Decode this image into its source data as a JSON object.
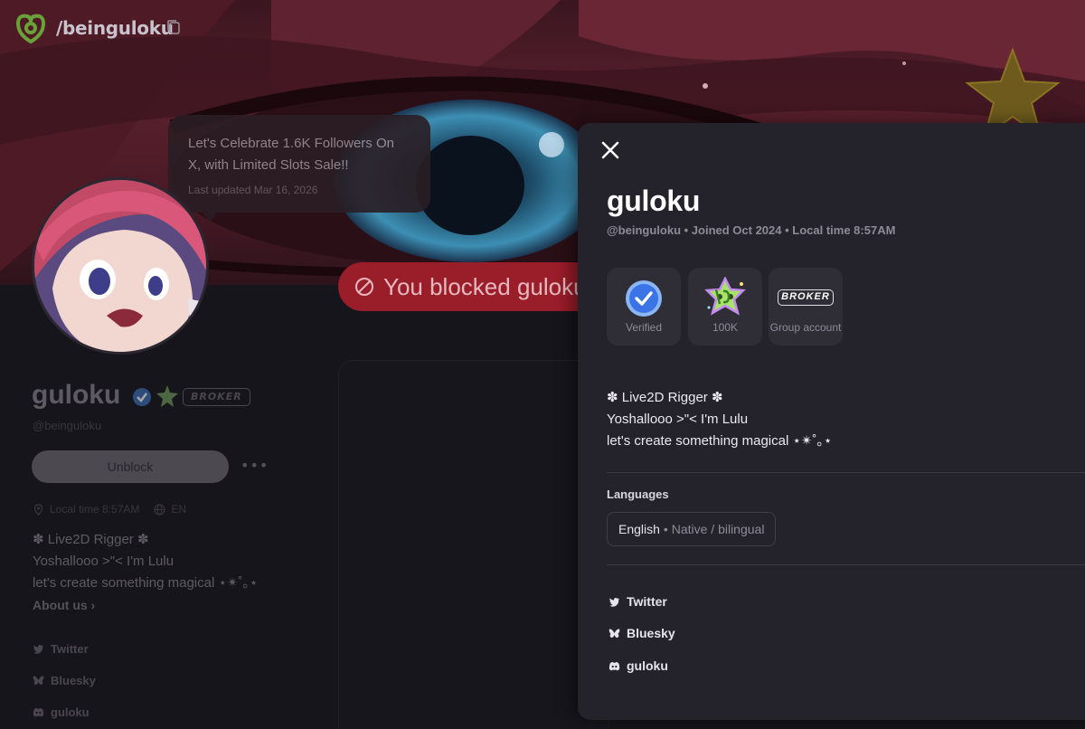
{
  "topbar": {
    "handle": "/beinguloku"
  },
  "banner": {
    "announcement": "Let's Celebrate 1.6K Followers On X, with Limited Slots Sale!!",
    "last_updated": "Last updated Mar 16, 2026",
    "blocked_message": "You blocked guloku"
  },
  "profile": {
    "name": "guloku",
    "handle": "@beinguloku",
    "broker_tag": "BROKER",
    "unblock_label": "Unblock",
    "more_label": "•••",
    "local_time": "Local time 8:57AM",
    "language_code": "EN",
    "bio": [
      "✽ Live2D Rigger ✽",
      "Yoshallooo >\"< I'm Lulu",
      "let's create something magical ⋆✴︎˚｡⋆"
    ],
    "about_label": "About us ›",
    "socials": [
      "Twitter",
      "Bluesky",
      "guloku"
    ]
  },
  "panel": {
    "name": "guloku",
    "meta": "@beinguloku • Joined Oct 2024 • Local time 8:57AM",
    "badges": [
      {
        "label": "Verified",
        "icon": "verified-check-icon"
      },
      {
        "label": "100K",
        "icon": "100k-badge-icon"
      },
      {
        "label": "Group account",
        "tag": "BROKER"
      }
    ],
    "bio": [
      "✽ Live2D Rigger ✽",
      "Yoshallooo >\"< I'm Lulu",
      "let's create something magical ⋆✴︎˚｡⋆"
    ],
    "languages_title": "Languages",
    "language": "English",
    "language_level": "• Native / bilingual",
    "socials": [
      {
        "label": "Twitter",
        "icon": "twitter-icon"
      },
      {
        "label": "Bluesky",
        "icon": "bluesky-icon"
      },
      {
        "label": "guloku",
        "icon": "discord-icon"
      }
    ]
  },
  "colors": {
    "panel_bg": "#24232b",
    "badge_bg": "#2f2e37",
    "blocked_red": "#9a1d2a",
    "verified_blue": "#3b82f6",
    "brand_green": "#7ab63c"
  }
}
